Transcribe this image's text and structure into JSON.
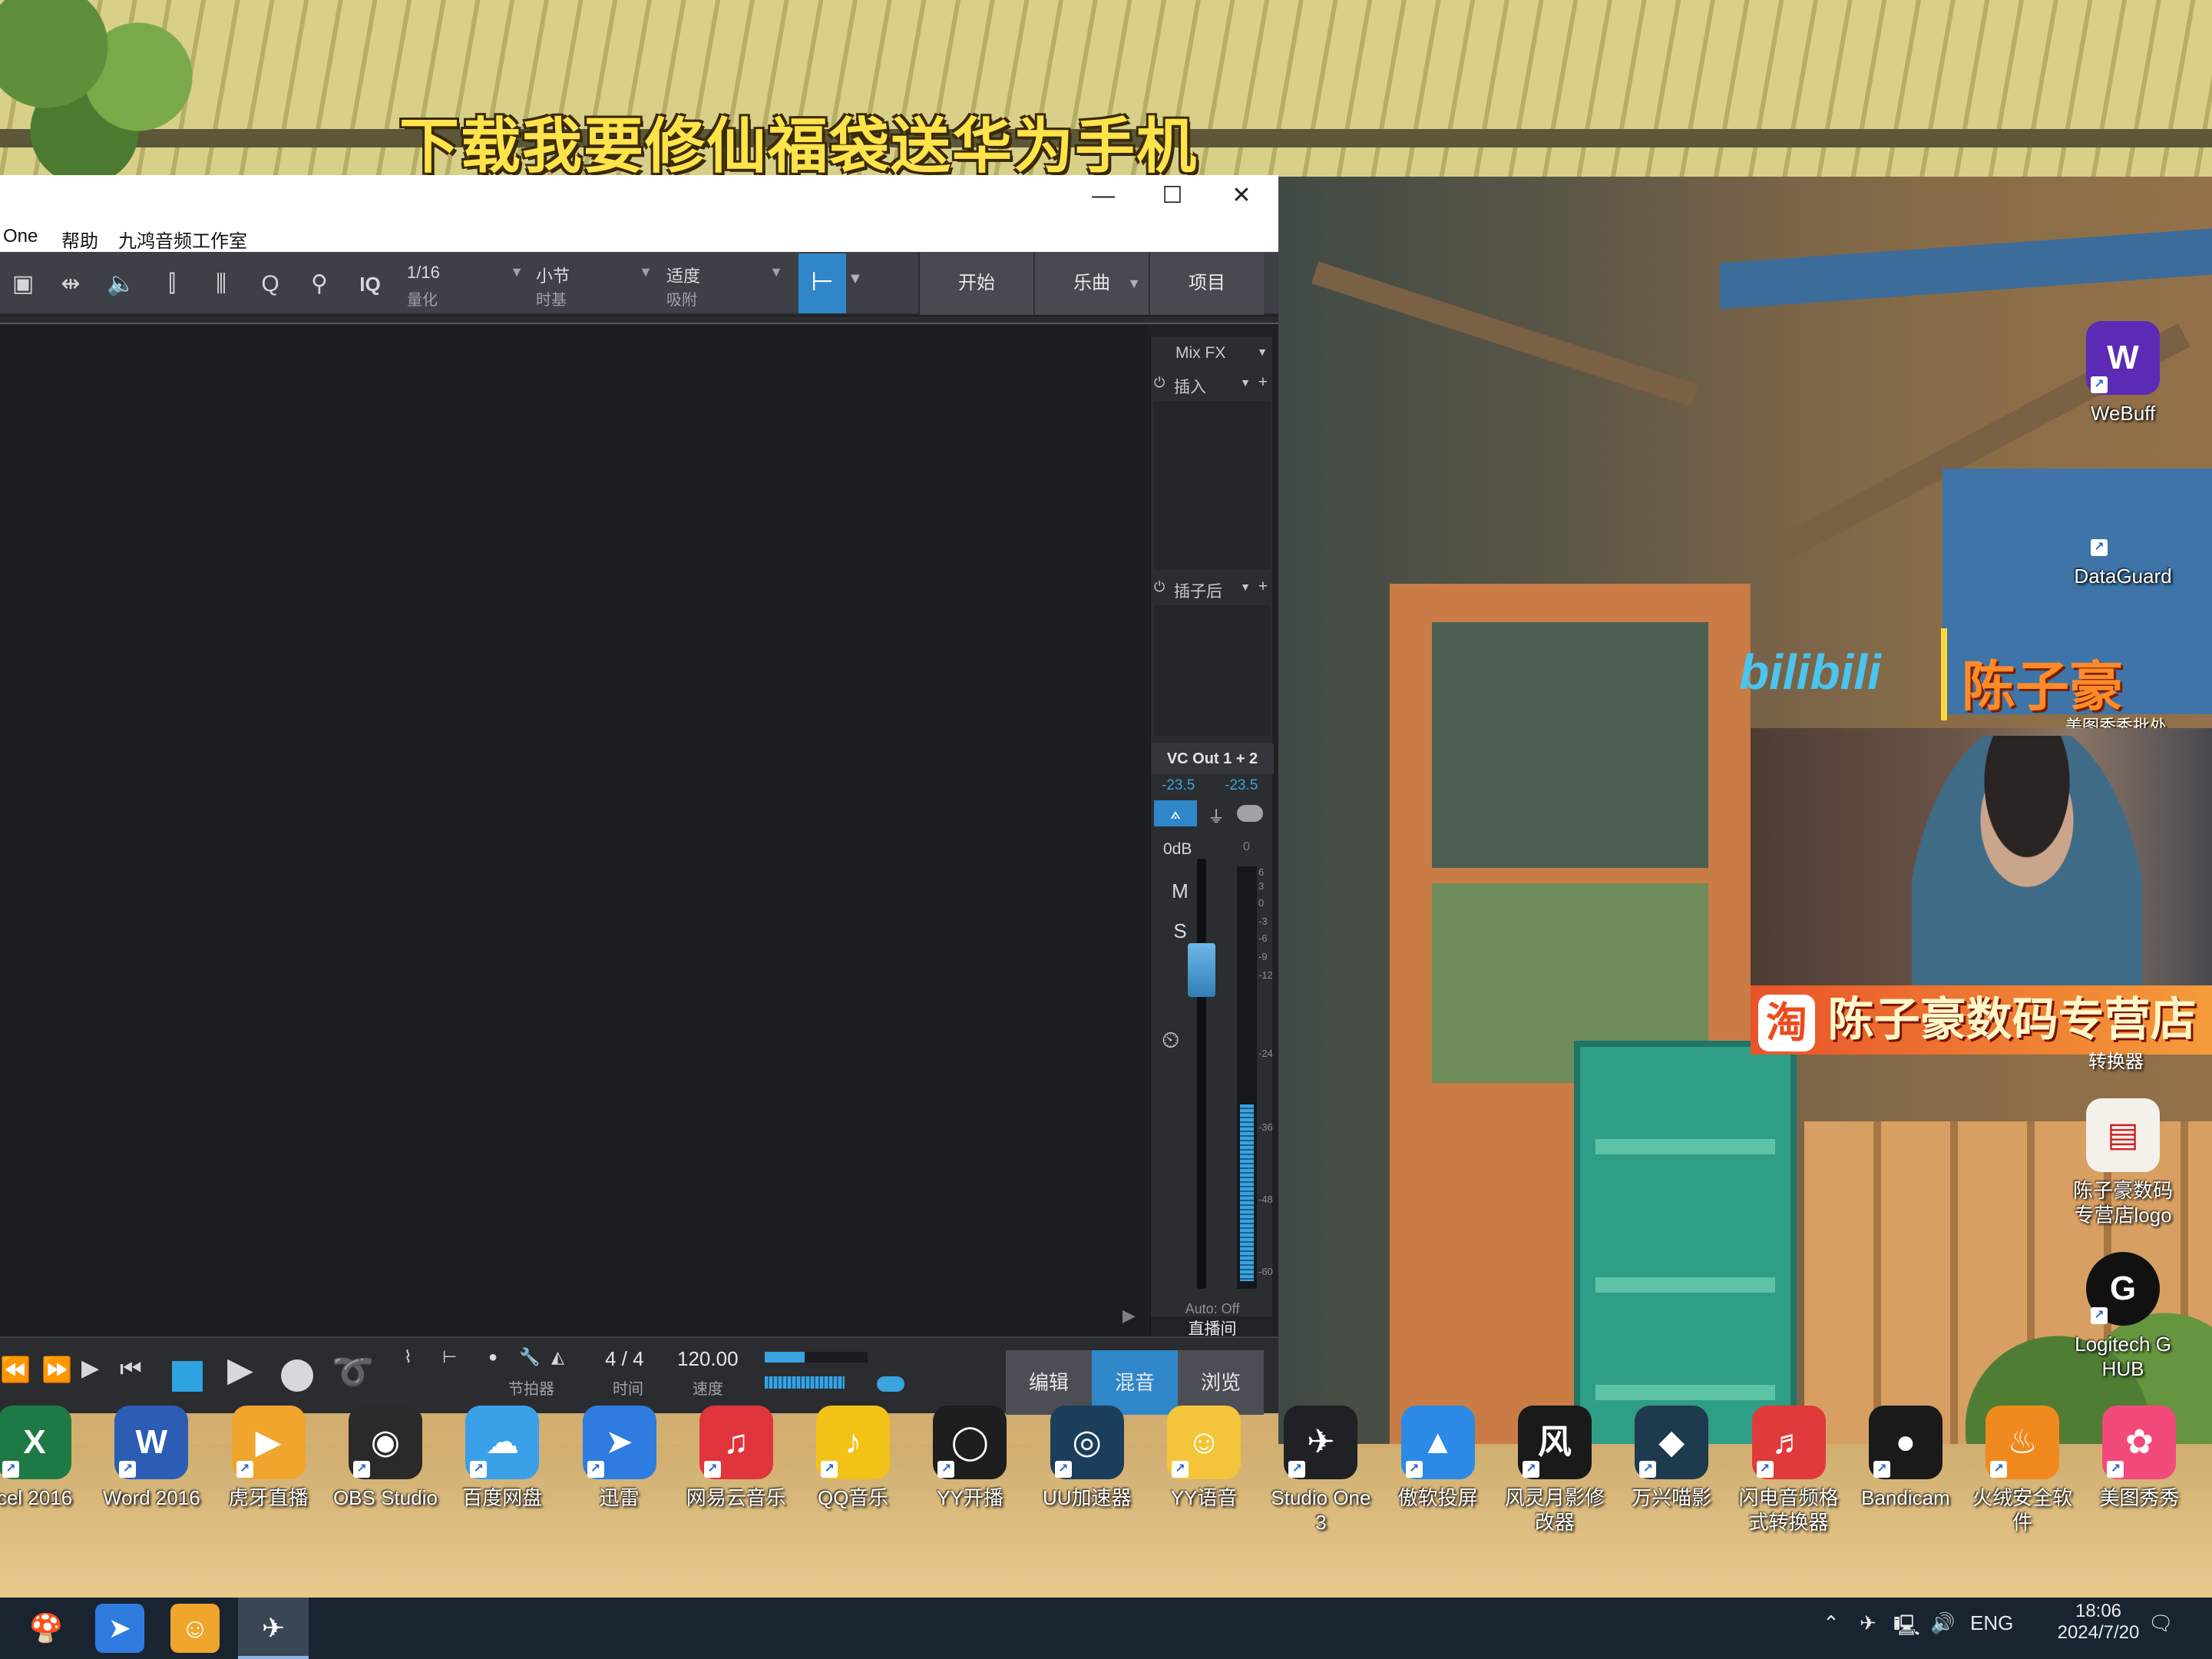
{
  "banner": {
    "text": "下载我要修仙福袋送华为手机"
  },
  "window": {
    "menu": [
      "One",
      "帮助",
      "九鸿音频工作室"
    ],
    "controls": {
      "minimize": "—",
      "maximize": "☐",
      "close": "✕"
    },
    "toolbar": {
      "quantize": {
        "value": "1/16",
        "label": "量化"
      },
      "timebase": {
        "value": "小节",
        "label": "时基"
      },
      "snap": {
        "value": "适度",
        "label": "吸附"
      },
      "iq_label": "IQ",
      "start_label": "开始",
      "song_label": "乐曲",
      "project_label": "项目"
    },
    "mixer": {
      "mixfx_label": "Mix FX",
      "insert_label": "插入",
      "post_insert_label": "插子后",
      "output_label": "VC Out 1 + 2",
      "peak_left": "-23.5",
      "peak_right": "-23.5",
      "gain_label": "0dB",
      "gain_zero": "0",
      "mute_label": "M",
      "solo_label": "S",
      "scale_labels": [
        "6",
        "3",
        "0",
        "-3",
        "-6",
        "-9",
        "-12",
        "-24",
        "-36",
        "-48",
        "-60"
      ],
      "auto_label": "Auto: Off",
      "channel_name": "直播间"
    },
    "transport": {
      "metronome_label": "节拍器",
      "time_sig": "4 / 4",
      "time_label": "时间",
      "tempo": "120.00",
      "tempo_label": "速度",
      "edit_label": "编辑",
      "mix_label": "混音",
      "browse_label": "浏览"
    }
  },
  "desktop_icons_row": [
    {
      "label": "cel 2016",
      "color": "#1e7a45",
      "glyph": "X"
    },
    {
      "label": "Word 2016",
      "color": "#2b5db5",
      "glyph": "W"
    },
    {
      "label": "虎牙直播",
      "color": "#f0a52c",
      "glyph": "▶"
    },
    {
      "label": "OBS Studio",
      "color": "#2a2a2a",
      "glyph": "◉"
    },
    {
      "label": "百度网盘",
      "color": "#3aa0e8",
      "glyph": "☁"
    },
    {
      "label": "迅雷",
      "color": "#2f7ce0",
      "glyph": "➤"
    },
    {
      "label": "网易云音乐",
      "color": "#e0353c",
      "glyph": "♫"
    },
    {
      "label": "QQ音乐",
      "color": "#f2c316",
      "glyph": "♪"
    },
    {
      "label": "YY开播",
      "color": "#1e1e1e",
      "glyph": "◯"
    },
    {
      "label": "UU加速器",
      "color": "#1a3e5c",
      "glyph": "◎"
    },
    {
      "label": "YY语音",
      "color": "#f4c53a",
      "glyph": "☺"
    },
    {
      "label": "Studio One 3",
      "color": "#1f2124",
      "glyph": "✈"
    },
    {
      "label": "傲软投屏",
      "color": "#2c8ae6",
      "glyph": "▲"
    },
    {
      "label": "风灵月影修改器",
      "color": "#1a1a1a",
      "glyph": "风"
    },
    {
      "label": "万兴喵影",
      "color": "#1e3a4e",
      "glyph": "◆"
    },
    {
      "label": "闪电音频格式转换器",
      "color": "#e03a3a",
      "glyph": "♬"
    },
    {
      "label": "Bandicam",
      "color": "#1a1a1a",
      "glyph": "●"
    },
    {
      "label": "火绒安全软件",
      "color": "#f08a1e",
      "glyph": "♨"
    },
    {
      "label": "美图秀秀",
      "color": "#f24a7a",
      "glyph": "✿"
    }
  ],
  "desktop_icons_col": [
    {
      "label": "WeBuff",
      "color": "#5b2bb5",
      "glyph": "W"
    },
    {
      "label": "DataGuard",
      "color": "transparent",
      "glyph": ""
    },
    {
      "label": "陈子豪数码专营店logo",
      "color": "#f4f0ea",
      "glyph": "▤"
    },
    {
      "label": "Logitech G HUB",
      "color": "#111111",
      "glyph": "G"
    }
  ],
  "overlays": {
    "bilibili": "bilibili",
    "streamer_name": "陈子豪",
    "shop_name": "陈子豪数码专营店",
    "shop_glyph": "淘",
    "meitu_label": "美图秀秀批处",
    "converter_label": "转换器"
  },
  "taskbar": {
    "lang": "ENG",
    "time": "18:06",
    "date": "2024/7/20"
  }
}
